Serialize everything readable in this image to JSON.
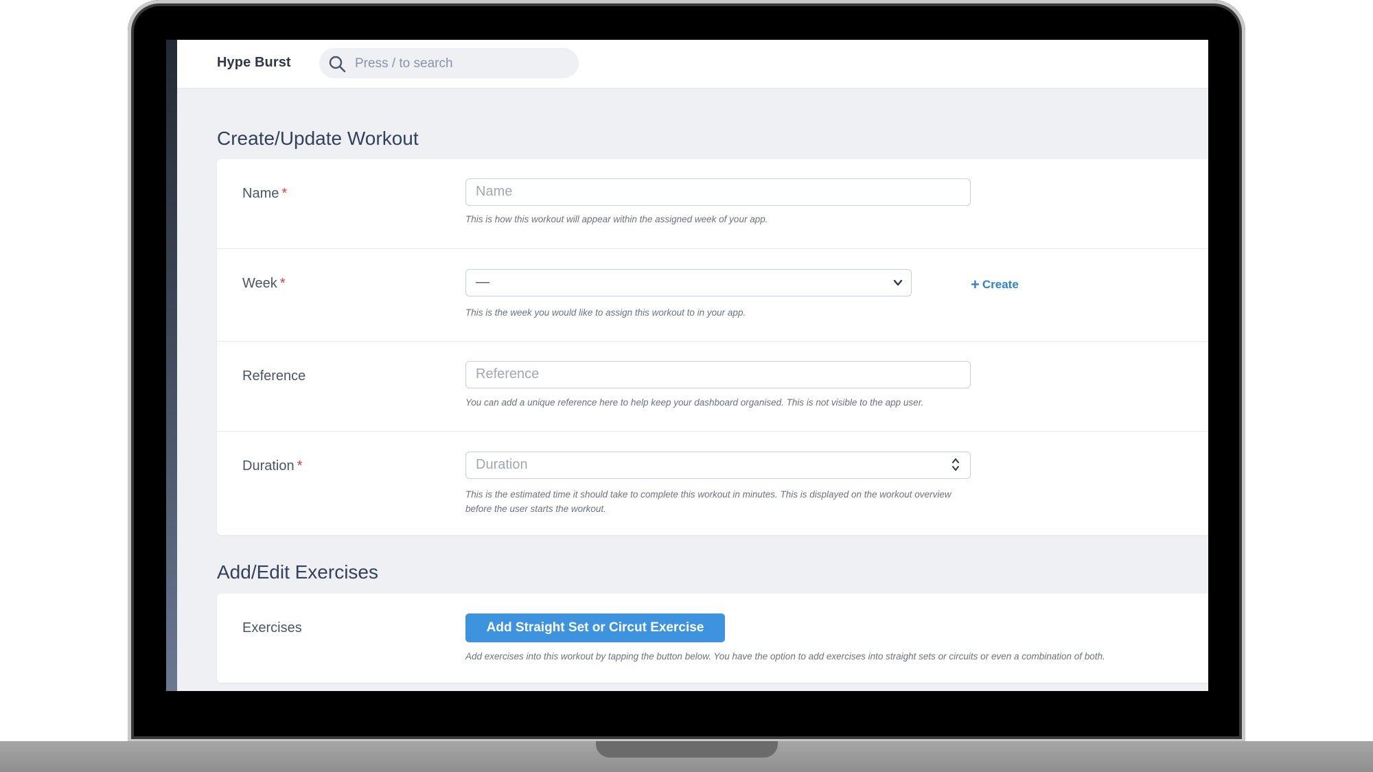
{
  "app": {
    "brand": "Hype Burst",
    "search_placeholder": "Press / to search"
  },
  "workout_section": {
    "title": "Create/Update Workout",
    "fields": {
      "name": {
        "label": "Name",
        "required_mark": "*",
        "placeholder": "Name",
        "help": "This is how this workout will appear within the assigned week of your app."
      },
      "week": {
        "label": "Week",
        "required_mark": "*",
        "selected_value": "—",
        "create_label": "Create",
        "help": "This is the week you would like to assign this workout to in your app."
      },
      "reference": {
        "label": "Reference",
        "placeholder": "Reference",
        "help": "You can add a unique reference here to help keep your dashboard organised. This is not visible to the app user."
      },
      "duration": {
        "label": "Duration",
        "required_mark": "*",
        "placeholder": "Duration",
        "help": "This is the estimated time it should take to complete this workout in minutes. This is displayed on the workout overview before the user starts the workout."
      }
    }
  },
  "exercises_section": {
    "title": "Add/Edit Exercises",
    "label": "Exercises",
    "button_label": "Add Straight Set or Circut Exercise",
    "help": "Add exercises into this workout by tapping the button below. You have the option to add exercises into straight sets or circuits or even a combination of both."
  },
  "colors": {
    "accent": "#3d93dd",
    "link": "#3182ce",
    "required": "#e53e3e",
    "page_background": "#eef0f4"
  },
  "icons": {
    "search": "search-icon",
    "dropdown": "chevron-down-icon",
    "spinner": "number-spinner-icon",
    "create": "plus-icon"
  }
}
